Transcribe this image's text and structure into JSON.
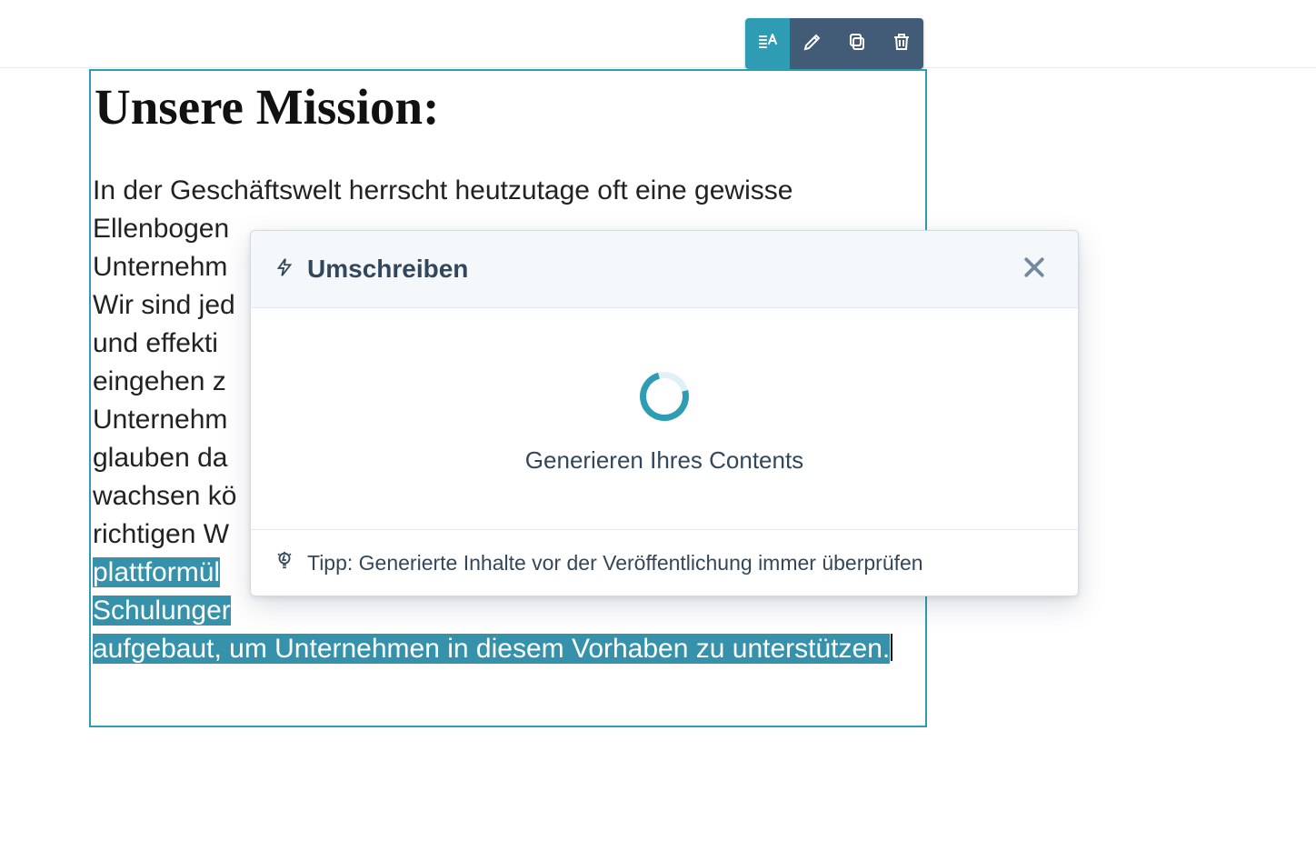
{
  "toolbar": {
    "active_tool": "text-style",
    "icons": [
      "text-style-icon",
      "pencil-icon",
      "copy-icon",
      "trash-icon"
    ]
  },
  "editor": {
    "heading": "Unsere Mission:",
    "body_plain_prefix": "In der Geschäftswelt herrscht heutzutage oft eine gewisse Ellenbogen",
    "body_trunc_lines": [
      "Unternehm",
      "Wir sind jed",
      "und effekti",
      "eingehen z",
      "Unternehm",
      "glauben da",
      "wachsen kö",
      "richtigen W"
    ],
    "body_selected_lines": [
      "plattformül",
      "Schulunger"
    ],
    "body_selected_tail": "aufgebaut, um Unternehmen in diesem Vorhaben zu unterstützen."
  },
  "modal": {
    "title": "Umschreiben",
    "status": "Generieren Ihres Contents",
    "tip": "Tipp: Generierte Inhalte vor der Veröffentlichung immer überprüfen"
  }
}
